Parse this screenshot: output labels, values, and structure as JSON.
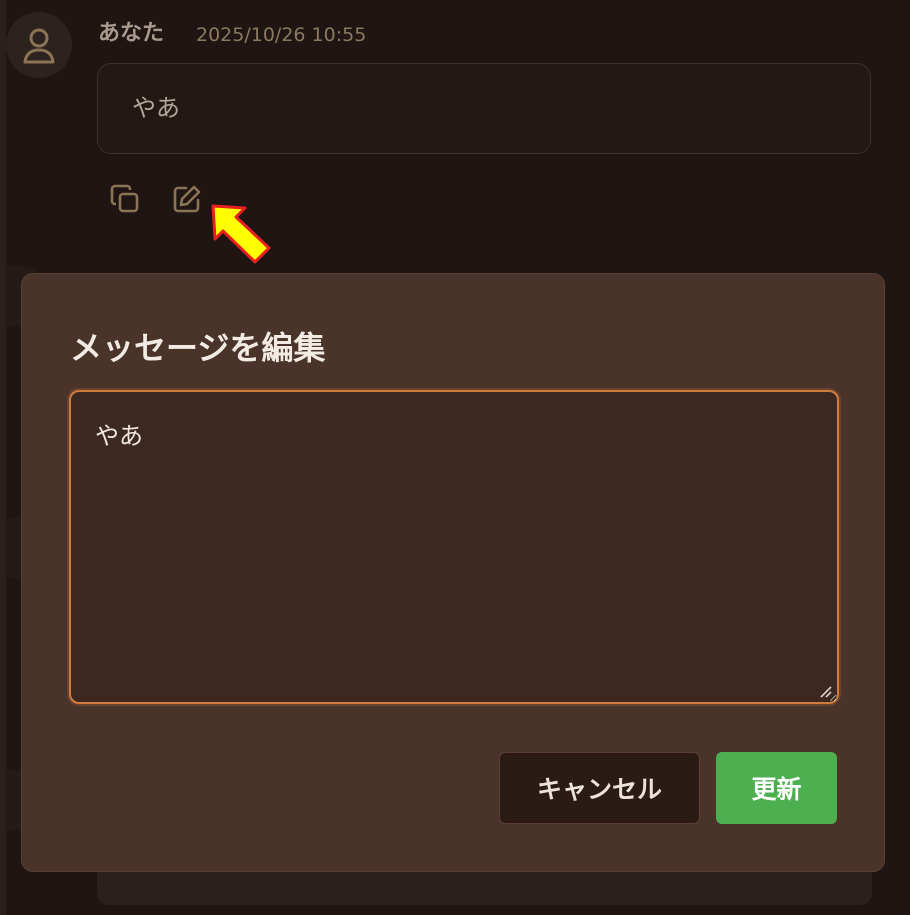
{
  "message": {
    "author": "あなた",
    "timestamp": "2025/10/26 10:55",
    "text": "やあ"
  },
  "actions": {
    "copy_icon": "copy-icon",
    "edit_icon": "edit-icon"
  },
  "modal": {
    "title": "メッセージを編集",
    "textarea_value": "やあ",
    "cancel_label": "キャンセル",
    "update_label": "更新"
  },
  "colors": {
    "background": "#1f1613",
    "modal_background": "#4a3329",
    "textarea_background": "#3c2820",
    "focus_border": "#d07c3f",
    "update_button": "#4caf50",
    "cancel_button": "#2a1b14",
    "icon": "#8b7355",
    "highlight_arrow": "#ffff00"
  }
}
